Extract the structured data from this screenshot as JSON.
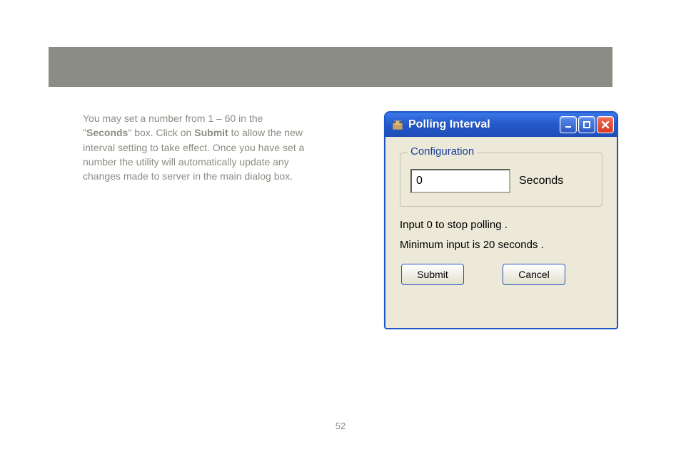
{
  "instructions": {
    "pre1": "You may set a number from 1 – 60 in the \"",
    "bold1": "Seconds",
    "mid1": "\" box.  Click on ",
    "bold2": "Submit",
    "post1": " to allow the new interval setting to take effect.  Once you have set a number the utility will automatically update any changes made to server in the main dialog box."
  },
  "dialog": {
    "title": "Polling Interval",
    "group_title": "Configuration",
    "input_value": "0",
    "seconds_label": "Seconds",
    "hint1": "Input 0 to stop polling .",
    "hint2": "Minimum input is 20 seconds .",
    "submit_label": "Submit",
    "cancel_label": "Cancel"
  },
  "page_number": "52"
}
